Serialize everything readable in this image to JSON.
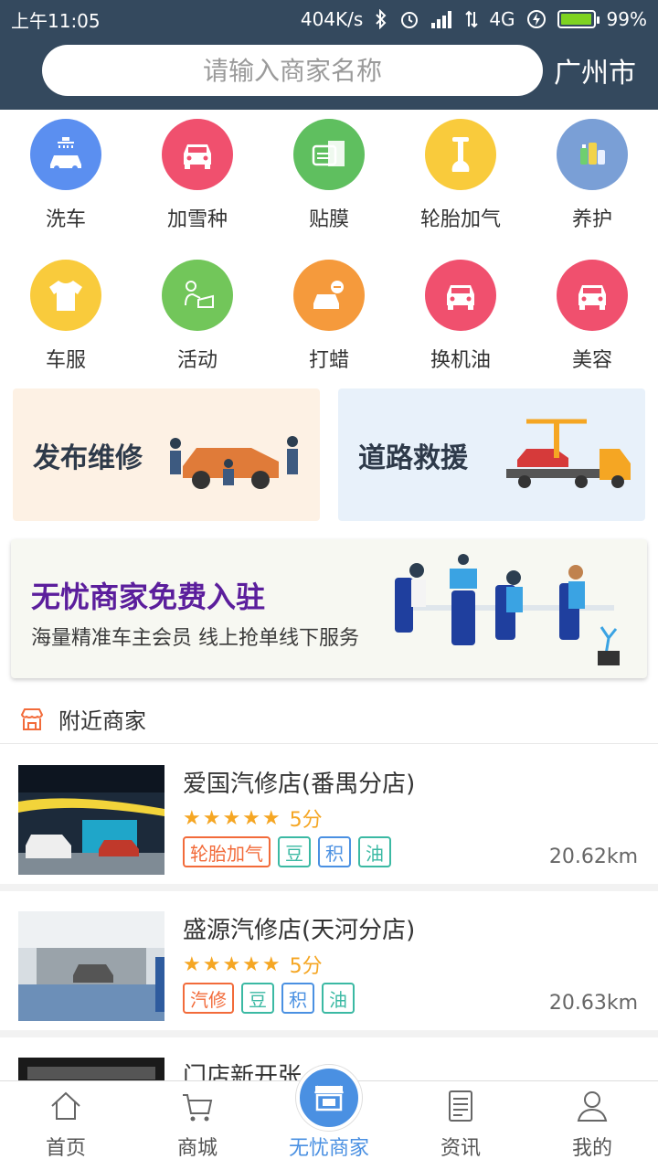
{
  "status_bar": {
    "time": "上午11:05",
    "network_speed": "404K/s",
    "network_type": "4G",
    "battery": "99%",
    "icons": [
      "bluetooth-icon",
      "alarm-icon",
      "signal-icon",
      "data-arrows-icon",
      "charging-icon",
      "battery-icon"
    ]
  },
  "search": {
    "placeholder": "请输入商家名称",
    "city": "广州市"
  },
  "categories": [
    {
      "label": "洗车",
      "icon": "car-wash-icon",
      "color": "#5b8ff0"
    },
    {
      "label": "加雪种",
      "icon": "car-icon",
      "color": "#f0506e"
    },
    {
      "label": "贴膜",
      "icon": "film-icon",
      "color": "#5fbf5f"
    },
    {
      "label": "轮胎加气",
      "icon": "pump-icon",
      "color": "#f9cb3c"
    },
    {
      "label": "养护",
      "icon": "care-products-icon",
      "color": "#7a9fd6"
    },
    {
      "label": "车服",
      "icon": "shirt-icon",
      "color": "#f9cb3c"
    },
    {
      "label": "活动",
      "icon": "activity-icon",
      "color": "#72c65a"
    },
    {
      "label": "打蜡",
      "icon": "wax-icon",
      "color": "#f59a3c"
    },
    {
      "label": "换机油",
      "icon": "car-icon",
      "color": "#f0506e"
    },
    {
      "label": "美容",
      "icon": "car-icon",
      "color": "#f0506e"
    }
  ],
  "services": {
    "repair_label": "发布维修",
    "rescue_label": "道路救援"
  },
  "merchant_banner": {
    "title": "无忧商家免费入驻",
    "subtitle": "海量精准车主会员  线上抢单线下服务"
  },
  "nearby": {
    "title": "附近商家",
    "shops": [
      {
        "name": "爱国汽修店(番禺分店)",
        "stars": "★★★★★",
        "score": "5分",
        "tags": [
          "轮胎加气",
          "豆",
          "积",
          "油"
        ],
        "distance": "20.62km"
      },
      {
        "name": "盛源汽修店(天河分店)",
        "stars": "★★★★★",
        "score": "5分",
        "tags": [
          "汽修",
          "豆",
          "积",
          "油"
        ],
        "distance": "20.63km"
      },
      {
        "name": "门店新开张",
        "stars": "",
        "score": "",
        "tags": [],
        "distance": ""
      }
    ]
  },
  "bottom_nav": [
    {
      "label": "首页",
      "icon": "home-icon"
    },
    {
      "label": "商城",
      "icon": "cart-icon"
    },
    {
      "label": "无忧商家",
      "icon": "store-icon",
      "active": true
    },
    {
      "label": "资讯",
      "icon": "news-icon"
    },
    {
      "label": "我的",
      "icon": "user-icon"
    }
  ],
  "colors": {
    "header": "#34495e",
    "accent": "#4a90e2",
    "star": "#f5a623"
  }
}
